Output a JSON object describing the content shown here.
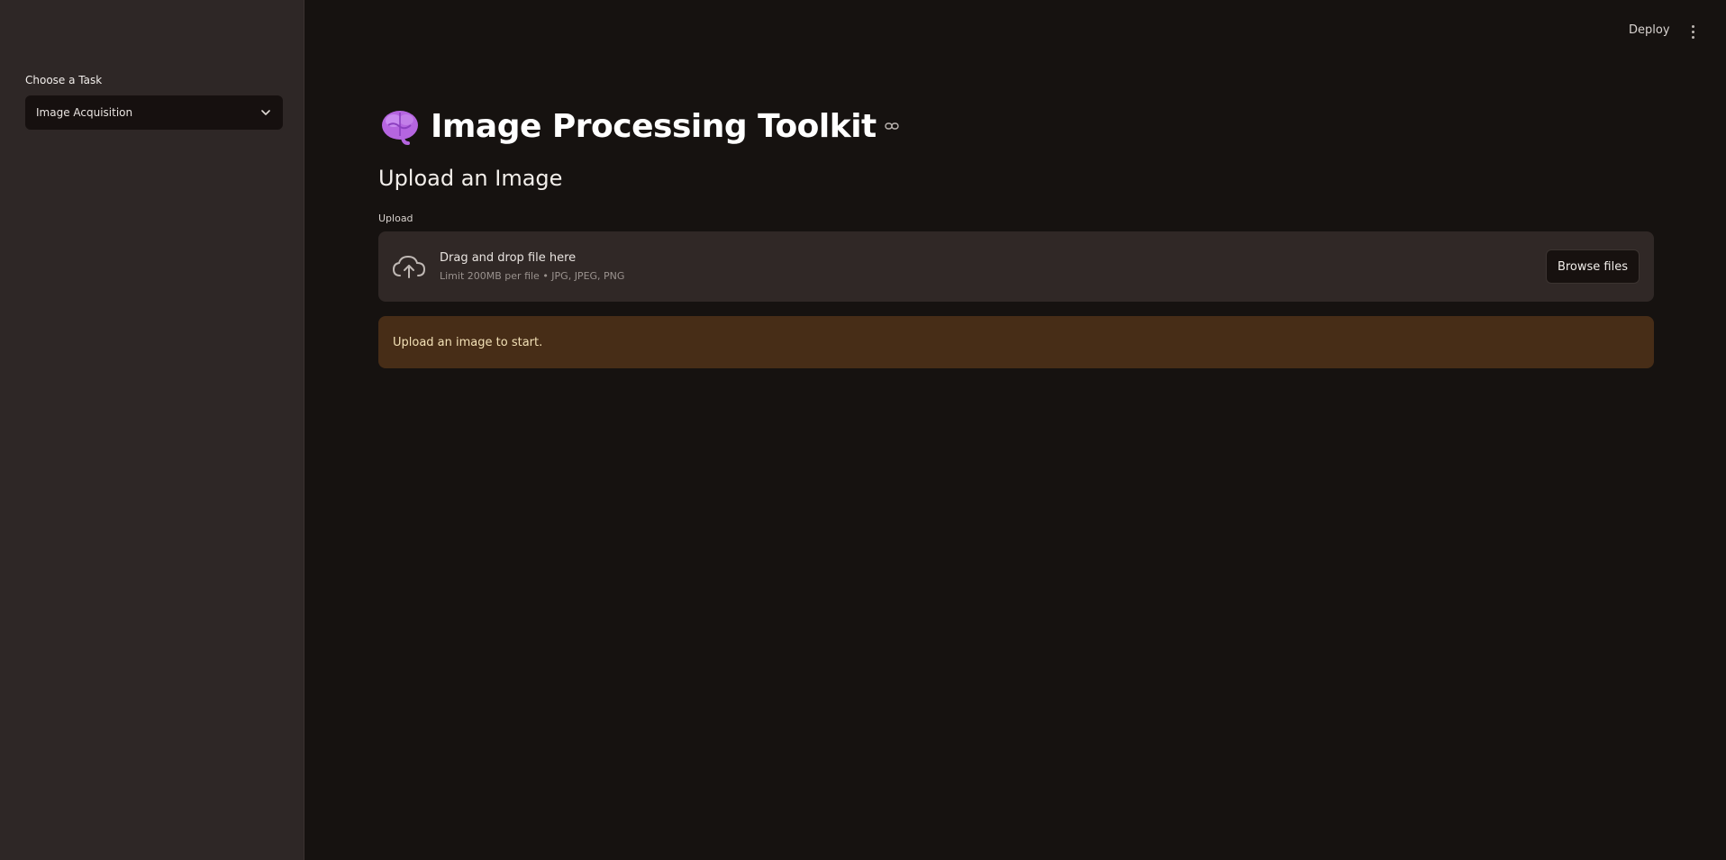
{
  "app": {
    "title": "Image Processing Toolkit"
  },
  "topbar": {
    "deploy_label": "Deploy",
    "menu_icon": "vertical-ellipsis-icon"
  },
  "sidebar": {
    "select_label": "Choose a Task",
    "select_value": "Image Acquisition"
  },
  "main": {
    "title_icon": "brain-icon",
    "section_heading": "Upload an Image",
    "uploader": {
      "label": "Upload",
      "primary_text": "Drag and drop file here",
      "secondary_text": "Limit 200MB per file • JPG, JPEG, PNG",
      "button_label": "Browse files"
    },
    "alert": {
      "text": "Upload an image to start."
    }
  },
  "colors": {
    "background": "#161210",
    "sidebar": "#2e2726",
    "uploader_bg": "#302826",
    "alert_bg": "#472d17",
    "alert_text": "#f2e0b5",
    "brain_accent": "#b565e0"
  }
}
